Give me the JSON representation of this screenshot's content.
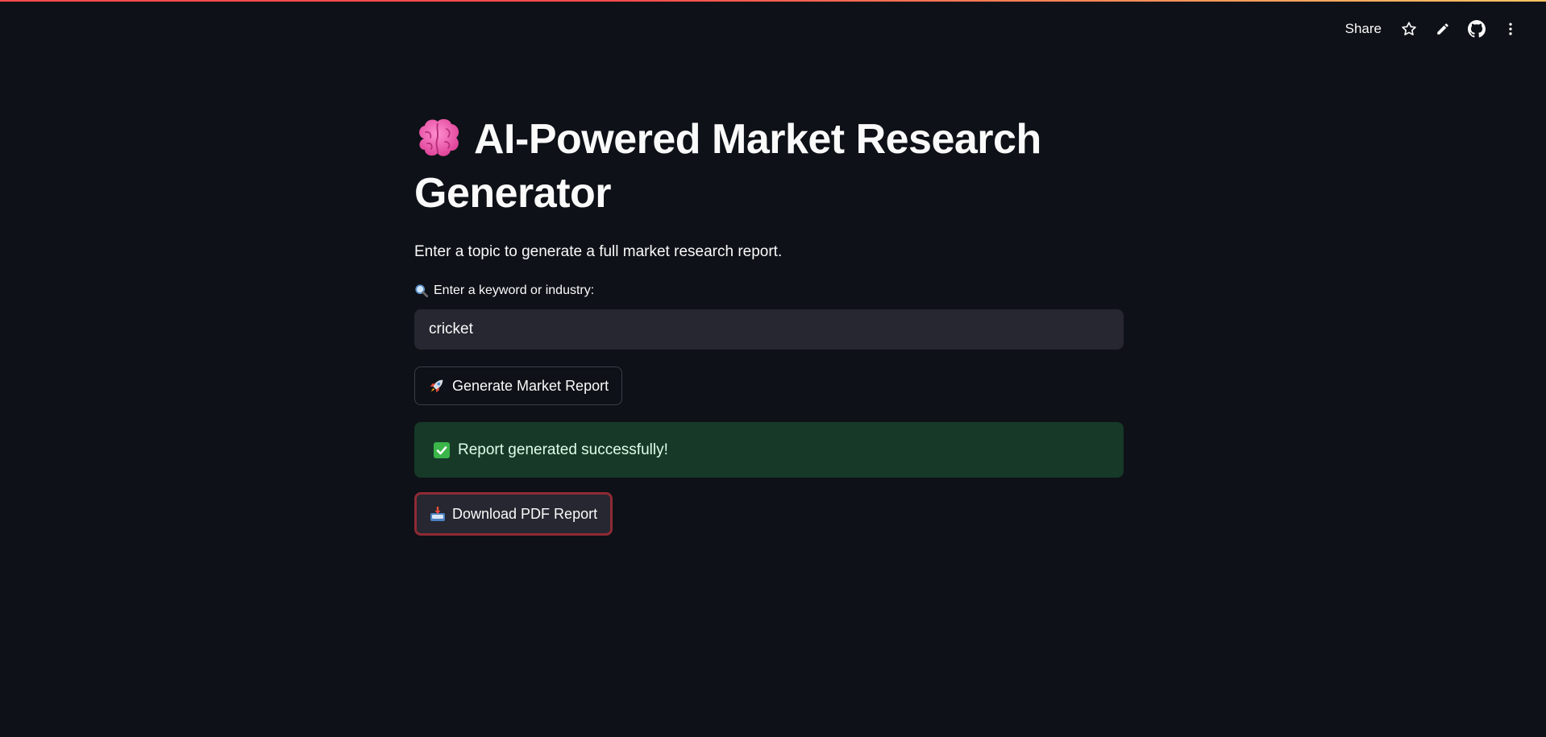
{
  "toolbar": {
    "share_label": "Share",
    "icons": [
      "star-icon",
      "pencil-icon",
      "github-icon",
      "kebab-menu-icon"
    ]
  },
  "header": {
    "title": "AI-Powered Market Research Generator",
    "title_icon": "brain-icon"
  },
  "main": {
    "subtitle": "Enter a topic to generate a full market research report.",
    "input_label": "Enter a keyword or industry:",
    "input_label_icon": "magnifier-icon",
    "input_value": "cricket",
    "generate_button_label": "Generate Market Report",
    "generate_button_icon": "rocket-icon",
    "success_message": "Report generated successfully!",
    "success_icon": "check-box-icon",
    "download_button_label": "Download PDF Report",
    "download_button_icon": "inbox-tray-icon"
  },
  "colors": {
    "background": "#0e1117",
    "input_background": "#262730",
    "success_background": "#173928",
    "focus_ring": "#8e2a35",
    "text": "#fafafa"
  }
}
